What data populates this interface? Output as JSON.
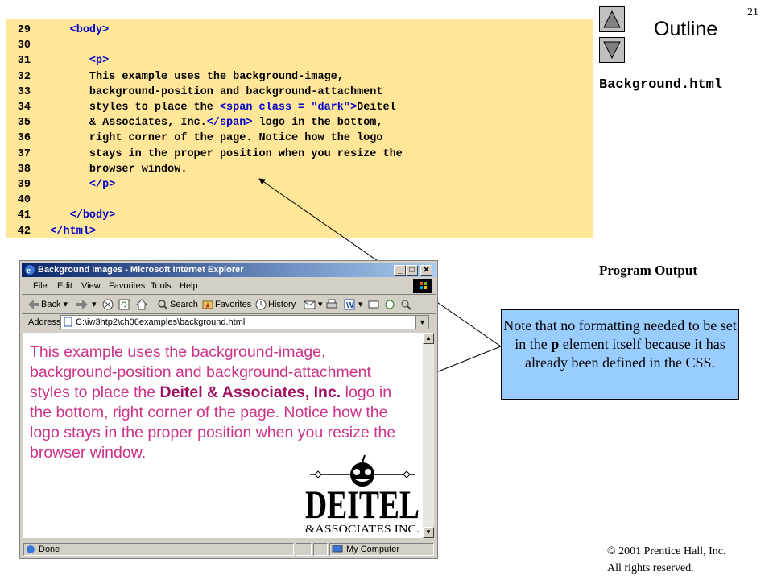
{
  "slide": {
    "number": "21",
    "outline_label": "Outline",
    "file_name": "Background.html",
    "program_output_label": "Program Output",
    "callout_pre": "Note that no formatting needed to be set in the ",
    "callout_bold": "p",
    "callout_post": " element itself because it has already been defined in the CSS.",
    "copyright_line1": "© 2001 Prentice Hall, Inc.",
    "copyright_line2": "All rights reserved."
  },
  "code": {
    "lines": [
      {
        "num": "29",
        "pre": "   ",
        "tag": "<body>",
        "post": ""
      },
      {
        "num": "30",
        "pre": "",
        "tag": "",
        "post": ""
      },
      {
        "num": "31",
        "pre": "      ",
        "tag": "<p>",
        "post": ""
      },
      {
        "num": "32",
        "pre": "      This example uses the background-image,",
        "tag": "",
        "post": ""
      },
      {
        "num": "33",
        "pre": "      background-position and background-attachment",
        "tag": "",
        "post": ""
      },
      {
        "num": "34",
        "pre": "      styles to place the ",
        "tag": "<span class = \"dark\">",
        "post": "Deitel"
      },
      {
        "num": "35",
        "pre": "      & Associates, Inc.",
        "tag": "</span>",
        "post": " logo in the bottom,"
      },
      {
        "num": "36",
        "pre": "      right corner of the page. Notice how the logo",
        "tag": "",
        "post": ""
      },
      {
        "num": "37",
        "pre": "      stays in the proper position when you resize the",
        "tag": "",
        "post": ""
      },
      {
        "num": "38",
        "pre": "      browser window.",
        "tag": "",
        "post": ""
      },
      {
        "num": "39",
        "pre": "      ",
        "tag": "</p>",
        "post": ""
      },
      {
        "num": "40",
        "pre": "",
        "tag": "",
        "post": ""
      },
      {
        "num": "41",
        "pre": "   ",
        "tag": "</body>",
        "post": ""
      },
      {
        "num": "42",
        "pre": "",
        "tag": "</html>",
        "post": ""
      }
    ]
  },
  "browser": {
    "title": "Background Images - Microsoft Internet Explorer",
    "menu": [
      "File",
      "Edit",
      "View",
      "Favorites",
      "Tools",
      "Help"
    ],
    "toolbar": {
      "back": "Back",
      "search": "Search",
      "favorites": "Favorites",
      "history": "History"
    },
    "address_label": "Address",
    "address_value": "C:\\iw3htp2\\ch06examples\\background.html",
    "page_text_pre": "This example uses the background-image, background-position and background-attachment styles to place the ",
    "page_text_bold": "Deitel & Associates, Inc.",
    "page_text_post": " logo in the bottom, right corner of the page. Notice how the logo stays in the proper position when you resize the browser window.",
    "logo_main": "DEITEL",
    "logo_sub": "&ASSOCIATES INC.",
    "status_text": "Done",
    "zone_text": "My Computer"
  },
  "colors": {
    "code_bg": "#ffe699",
    "code_tag": "#0000cc",
    "callout_bg": "#99ccff",
    "page_text": "#cc3388"
  }
}
